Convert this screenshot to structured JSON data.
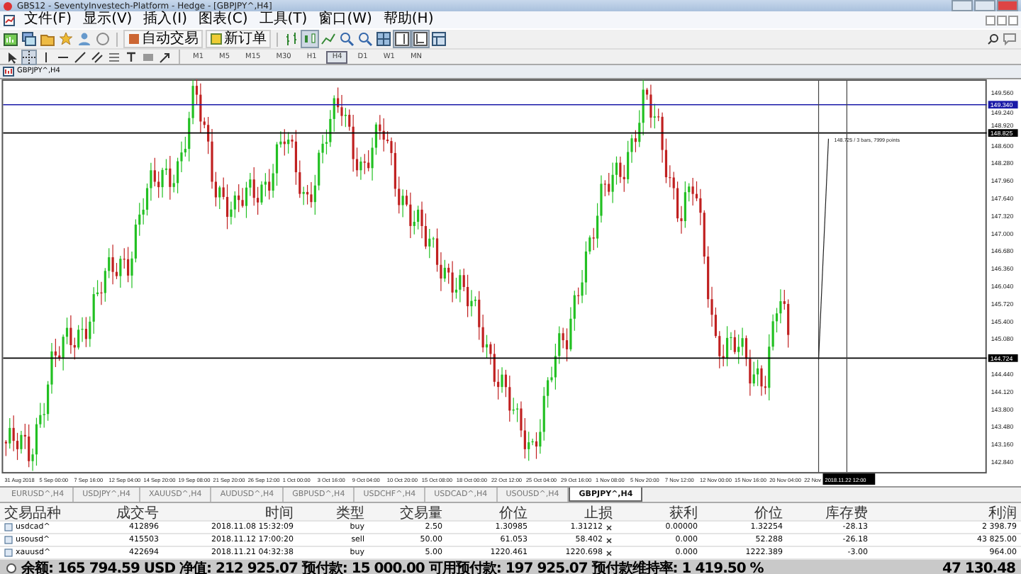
{
  "window": {
    "title": "GBS12 - SeventyInvestech-Platform - Hedge - [GBPJPY^,H4]"
  },
  "menu": [
    "文件(F)",
    "显示(V)",
    "插入(I)",
    "图表(C)",
    "工具(T)",
    "窗口(W)",
    "帮助(H)"
  ],
  "toolbar": {
    "auto_trading": "自动交易",
    "new_order": "新订单"
  },
  "timeframes": [
    {
      "label": "M1",
      "selected": false
    },
    {
      "label": "M5",
      "selected": false
    },
    {
      "label": "M15",
      "selected": false
    },
    {
      "label": "M30",
      "selected": false
    },
    {
      "label": "H1",
      "selected": false
    },
    {
      "label": "H4",
      "selected": true
    },
    {
      "label": "D1",
      "selected": false
    },
    {
      "label": "W1",
      "selected": false
    },
    {
      "label": "MN",
      "selected": false
    }
  ],
  "chart": {
    "title": "GBPJPY^,H4",
    "price_labels": [
      "149.560",
      "149.240",
      "148.920",
      "148.600",
      "148.280",
      "147.960",
      "147.640",
      "147.320",
      "147.000",
      "146.680",
      "146.360",
      "146.040",
      "145.720",
      "145.400",
      "145.080",
      "144.440",
      "144.120",
      "143.800",
      "143.480",
      "143.160",
      "142.840"
    ],
    "time_labels": [
      "31 Aug 2018",
      "5 Sep 00:00",
      "7 Sep 16:00",
      "12 Sep 04:00",
      "14 Sep 20:00",
      "19 Sep 08:00",
      "21 Sep 20:00",
      "26 Sep 12:00",
      "1 Oct 00:00",
      "3 Oct 16:00",
      "9 Oct 04:00",
      "10 Oct 20:00",
      "15 Oct 08:00",
      "18 Oct 00:00",
      "22 Oct 12:00",
      "25 Oct 04:00",
      "29 Oct 16:00",
      "1 Nov 08:00",
      "5 Nov 20:00",
      "7 Nov 12:00",
      "12 Nov 00:00",
      "15 Nov 16:00",
      "20 Nov 04:00",
      "22 Nov"
    ],
    "price_lines": [
      {
        "label": "149.340",
        "color": "#1a1aa8"
      },
      {
        "label": "148.825",
        "color": "#000000"
      },
      {
        "label": "144.724",
        "color": "#000000"
      }
    ],
    "cursor_time": "2018.11.22 12:00",
    "measure": "148.725 / 3 bars, 7999 points"
  },
  "chart_tabs": [
    {
      "label": "EURUSD^,H4",
      "selected": false
    },
    {
      "label": "USDJPY^,H4",
      "selected": false
    },
    {
      "label": "XAUUSD^,H4",
      "selected": false
    },
    {
      "label": "AUDUSD^,H4",
      "selected": false
    },
    {
      "label": "GBPUSD^,H4",
      "selected": false
    },
    {
      "label": "USDCHF^,H4",
      "selected": false
    },
    {
      "label": "USDCAD^,H4",
      "selected": false
    },
    {
      "label": "USOUSD^,H4",
      "selected": false
    },
    {
      "label": "GBPJPY^,H4",
      "selected": true
    }
  ],
  "trades": {
    "columns": [
      "交易品种",
      "成交号",
      "时间",
      "类型",
      "交易量",
      "价位",
      "止损",
      "获利",
      "价位",
      "库存费",
      "利润"
    ],
    "rows": [
      [
        "usdcad^",
        "412896",
        "2018.11.08 15:32:09",
        "buy",
        "2.50",
        "1.30985",
        "1.31212",
        "0.00000",
        "1.32254",
        "-28.13",
        "2 398.79"
      ],
      [
        "usousd^",
        "415503",
        "2018.11.12 17:00:20",
        "sell",
        "50.00",
        "61.053",
        "58.402",
        "0.000",
        "52.288",
        "-26.18",
        "43 825.00"
      ],
      [
        "xauusd^",
        "422694",
        "2018.11.21 04:32:38",
        "buy",
        "5.00",
        "1220.461",
        "1220.698",
        "0.000",
        "1222.389",
        "-3.00",
        "964.00"
      ]
    ],
    "summary": "余额: 165 794.59 USD  净值: 212 925.07  预付款: 15 000.00  可用预付款: 197 925.07  预付款维持率: 1 419.50 %",
    "total": "47 130.48"
  }
}
